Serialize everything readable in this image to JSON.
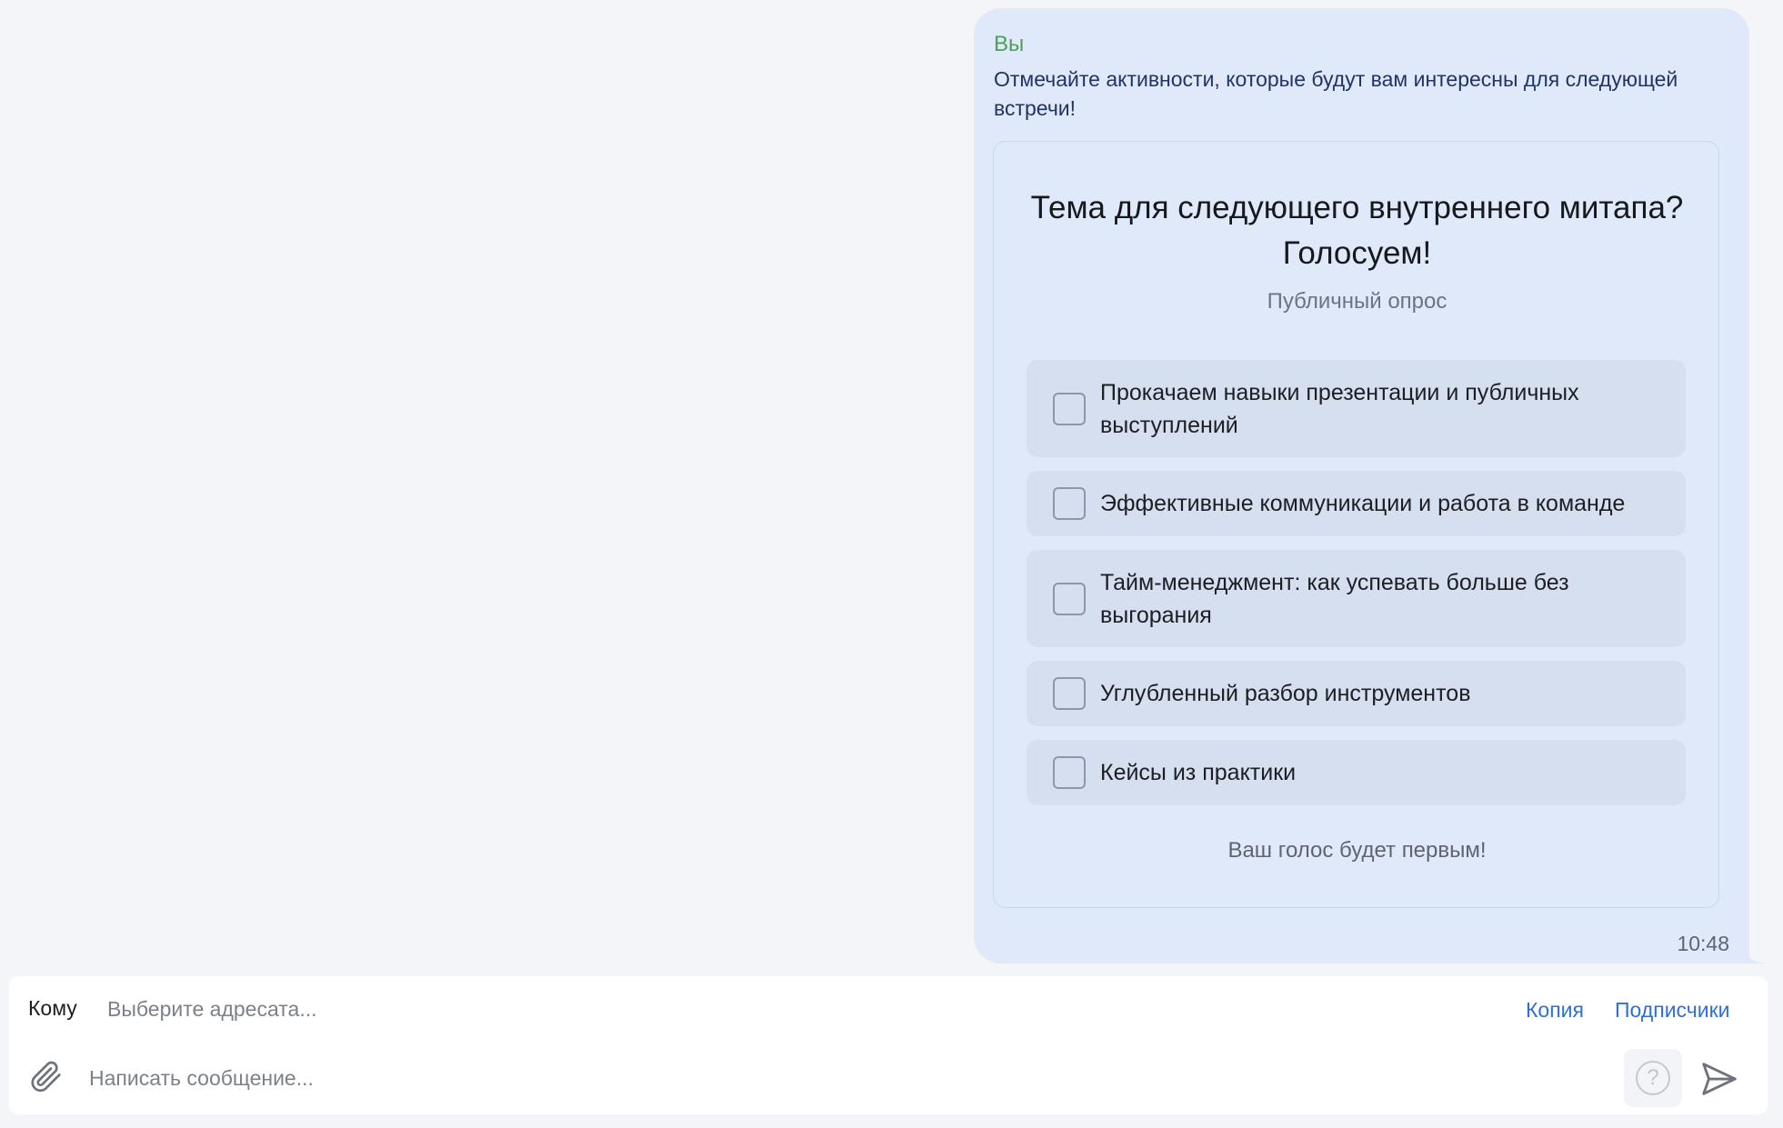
{
  "message": {
    "sender": "Вы",
    "text": "Отмечайте активности, которые будут вам интересны для следующей встречи!",
    "time": "10:48"
  },
  "poll": {
    "title": "Тема для следующего внутреннего митапа? Голосуем!",
    "subtitle": "Публичный опрос",
    "options": [
      {
        "label": "Прокачаем навыки презентации и публичных выступлений",
        "checked": false
      },
      {
        "label": "Эффективные коммуникации и работа в команде",
        "checked": false
      },
      {
        "label": "Тайм-менеджмент: как успевать больше без выгорания",
        "checked": false
      },
      {
        "label": "Углубленный разбор инструментов",
        "checked": false
      },
      {
        "label": "Кейсы из практики",
        "checked": false
      }
    ],
    "footer": "Ваш голос будет первым!"
  },
  "composer": {
    "to_label": "Кому",
    "to_value": "",
    "to_placeholder": "Выберите адресата...",
    "copy_link": "Копия",
    "subscribers_link": "Подписчики",
    "message_value": "",
    "message_placeholder": "Написать сообщение...",
    "help_glyph": "?"
  },
  "icons": {
    "attach": "paperclip-icon",
    "help": "question-circle-icon",
    "send": "send-icon"
  },
  "colors": {
    "bubble": "#dfe9fa",
    "option_bg": "#d5dff0",
    "sender": "#4ca254",
    "link": "#2e6fd8"
  }
}
